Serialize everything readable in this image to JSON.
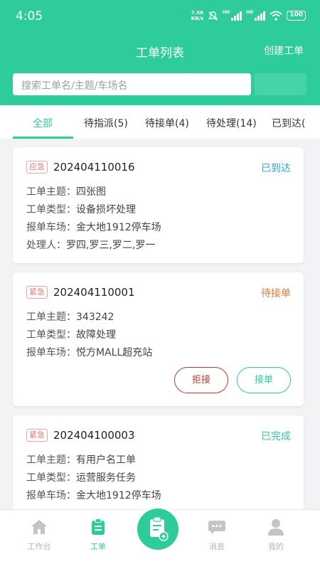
{
  "status_bar": {
    "time": "4:05",
    "net_speed_value": "7.56",
    "net_speed_unit": "KB/s",
    "signal1_label": "HD",
    "signal2_label": "HD",
    "battery": "100"
  },
  "header": {
    "title": "工单列表",
    "create_label": "创建工单"
  },
  "search": {
    "placeholder": "搜索工单名/主题/车场名"
  },
  "tabs": [
    {
      "label": "全部",
      "active": true
    },
    {
      "label": "待指派(5)"
    },
    {
      "label": "待接单(4)"
    },
    {
      "label": "待处理(14)"
    },
    {
      "label": "已到达("
    }
  ],
  "orders": [
    {
      "tag": "应急",
      "number": "202404110016",
      "status": "已到达",
      "status_color": "#2aa7d6",
      "fields": [
        {
          "key": "工单主题：",
          "value": "四张图"
        },
        {
          "key": "工单类型：",
          "value": "设备损坏处理"
        },
        {
          "key": "报单车场：",
          "value": "金大地1912停车场"
        },
        {
          "key": "处理人：",
          "value": "罗四,罗三,罗二,罗一"
        }
      ]
    },
    {
      "tag": "紧急",
      "number": "202404110001",
      "status": "待接单",
      "status_color": "#e07b39",
      "fields": [
        {
          "key": "工单主题：",
          "value": "343242"
        },
        {
          "key": "工单类型：",
          "value": "故障处理"
        },
        {
          "key": "报单车场：",
          "value": "悦方MALL超充站"
        }
      ],
      "reject_label": "拒接",
      "accept_label": "接单"
    },
    {
      "tag": "紧急",
      "number": "202404100003",
      "status": "已完成",
      "status_color": "#2ecc9a",
      "fields": [
        {
          "key": "工单主题：",
          "value": "有用户名工单"
        },
        {
          "key": "工单类型：",
          "value": "运营服务任务"
        },
        {
          "key": "报单车场：",
          "value": "金大地1912停车场"
        }
      ]
    }
  ],
  "bottom_nav": [
    {
      "label": "工作台",
      "icon": "home-icon"
    },
    {
      "label": "工单",
      "icon": "clipboard-icon",
      "active": true
    },
    {
      "label": "",
      "icon": "add-clipboard-icon"
    },
    {
      "label": "消息",
      "icon": "chat-icon"
    },
    {
      "label": "我的",
      "icon": "user-icon"
    }
  ],
  "colors": {
    "accent": "#2ecc9a",
    "reject": "#c0392b",
    "tag": "#e07a7a"
  }
}
